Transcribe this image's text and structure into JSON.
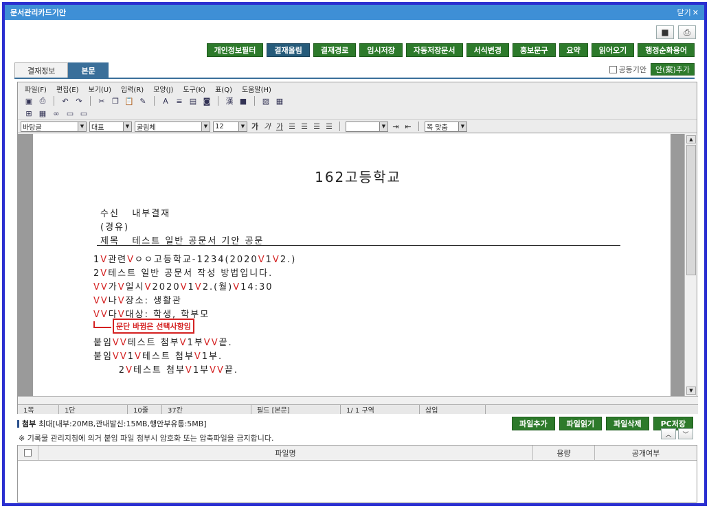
{
  "window": {
    "title": "문서관리카드기안",
    "close_label": "닫기",
    "close_icon": "close-icon"
  },
  "top_icons": [
    "save-icon",
    "print-icon"
  ],
  "actions": [
    "개인정보필터",
    "결재올림",
    "결재경로",
    "임시저장",
    "자동저장문서",
    "서식변경",
    "홍보문구",
    "요약",
    "읽어오기",
    "행정순화용어"
  ],
  "tabs": [
    {
      "label": "결재정보"
    },
    {
      "label": "본문"
    }
  ],
  "cosign": {
    "label": "공동기안",
    "add_label": "안(案)추가"
  },
  "menu": [
    "파일(F)",
    "편집(E)",
    "보기(U)",
    "입력(R)",
    "모양(J)",
    "도구(K)",
    "표(Q)",
    "도움말(H)"
  ],
  "format": {
    "style": "바탕글",
    "lang": "대표",
    "font": "굴림체",
    "size": "12",
    "bold": "가",
    "italic": "가",
    "underline": "가",
    "width": "쪽 맞춤"
  },
  "document": {
    "title": "162고등학교",
    "recipient_label": "수신",
    "recipient": "내부결재",
    "via": "(경유)",
    "subject_label": "제목",
    "subject": "테스트 일반 공문서 기안 공문",
    "lines": [
      {
        "pre": "",
        "segs": [
          "1",
          "V",
          "관련",
          "V",
          "ㅇㅇ고등학교-1234(2020",
          "V",
          "1",
          "V",
          "2.)"
        ]
      },
      {
        "pre": "",
        "segs": [
          "2",
          "V",
          "테스트 일반 공문서 작성 방법입니다."
        ]
      },
      {
        "pre": "",
        "segs": [
          "",
          "VV",
          "가",
          "V",
          "일시",
          "V",
          "2020",
          "V",
          "1",
          "V",
          "2.(월)",
          "V",
          "14:30"
        ]
      },
      {
        "pre": "",
        "segs": [
          "",
          "VV",
          "나",
          "V",
          "장소: 생활관"
        ]
      },
      {
        "pre": "",
        "segs": [
          "",
          "VV",
          "다",
          "V",
          "대상: 학생, 학부모"
        ]
      }
    ],
    "note": "문단 바뀜은 선택사항임",
    "attach_lines": [
      {
        "segs": [
          "붙임",
          "VV",
          "테스트 첨부",
          "V",
          "1부",
          "VV",
          "끝."
        ]
      },
      {
        "segs": [
          "붙임",
          "VV",
          "1",
          "V",
          "테스트 첨부",
          "V",
          "1부."
        ]
      },
      {
        "segs": [
          "      2",
          "V",
          "테스트 첨부",
          "V",
          "1부",
          "VV",
          "끝."
        ]
      }
    ]
  },
  "status": {
    "page": "1쪽",
    "col": "1단",
    "line": "10줄",
    "char": "37칸",
    "field": "필드 [본문]",
    "section": "1/ 1 구역",
    "mode": "삽입"
  },
  "attach": {
    "label": "첨부",
    "limit": "최대[내부:20MB,관내발신:15MB,행안부유통:5MB]",
    "warning": "※ 기록물 관리지침에 의거 붙임 파일 첨부시 암호화 또는 압축파일을 금지합니다.",
    "buttons": [
      "파일추가",
      "파일읽기",
      "파일삭제",
      "PC저장"
    ],
    "columns": [
      "파일명",
      "용량",
      "공개여부"
    ]
  },
  "colors": {
    "frame": "#2a2fd0",
    "titlebar": "#3e8fd6",
    "green_button": "#2d7a2b",
    "tab_active": "#3a6f9a",
    "annotation": "#d42020"
  }
}
